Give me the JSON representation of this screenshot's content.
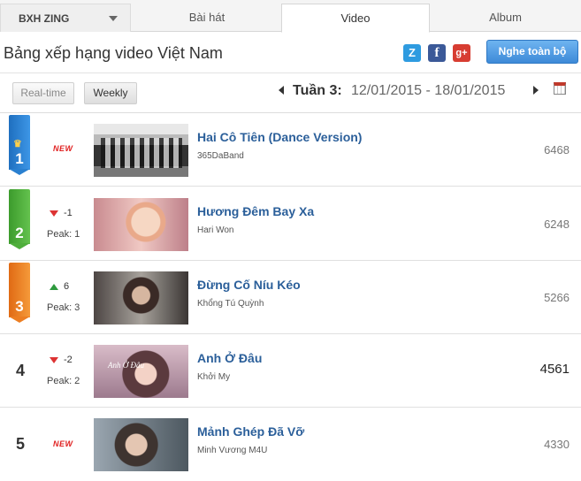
{
  "tabs": {
    "bxh": "BXH ZING",
    "baihat": "Bài hát",
    "video": "Video",
    "album": "Album"
  },
  "header": {
    "title": "Bảng xếp hạng video Việt Nam",
    "play_all": "Nghe toàn bộ",
    "share_icons": [
      "zing-icon",
      "facebook-icon",
      "google-plus-icon"
    ]
  },
  "filters": {
    "realtime": "Real-time",
    "weekly": "Weekly",
    "week_label": "Tuần 3:",
    "week_range": "12/01/2015 - 18/01/2015"
  },
  "rows": [
    {
      "rank": "1",
      "badge": "NEW",
      "change": "",
      "peak": "",
      "title": "Hai Cô Tiên (Dance Version)",
      "artist": "365DaBand",
      "views": "6468"
    },
    {
      "rank": "2",
      "badge": "",
      "change": "-1",
      "peak": "Peak: 1",
      "title": "Hương Đêm Bay Xa",
      "artist": "Hari Won",
      "views": "6248"
    },
    {
      "rank": "3",
      "badge": "",
      "change": "6",
      "peak": "Peak: 3",
      "title": "Đừng Cố Níu Kéo",
      "artist": "Khổng Tú Quỳnh",
      "views": "5266"
    },
    {
      "rank": "4",
      "badge": "",
      "change": "-2",
      "peak": "Peak: 2",
      "title": "Anh Ở Đâu",
      "artist": "Khởi My",
      "views": "4561",
      "thumb_text": "Anh Ở Đâu"
    },
    {
      "rank": "5",
      "badge": "NEW",
      "change": "",
      "peak": "",
      "title": "Mảnh Ghép Đã Vỡ",
      "artist": "Minh Vương M4U",
      "views": "4330"
    }
  ],
  "colors": {
    "title_link": "#2b5f9a",
    "rank1": "#2a80d0",
    "rank2": "#4fae3c",
    "rank3": "#ec7e22",
    "new_badge": "#e02020",
    "down": "#dd3333",
    "up": "#2e9a3e"
  }
}
